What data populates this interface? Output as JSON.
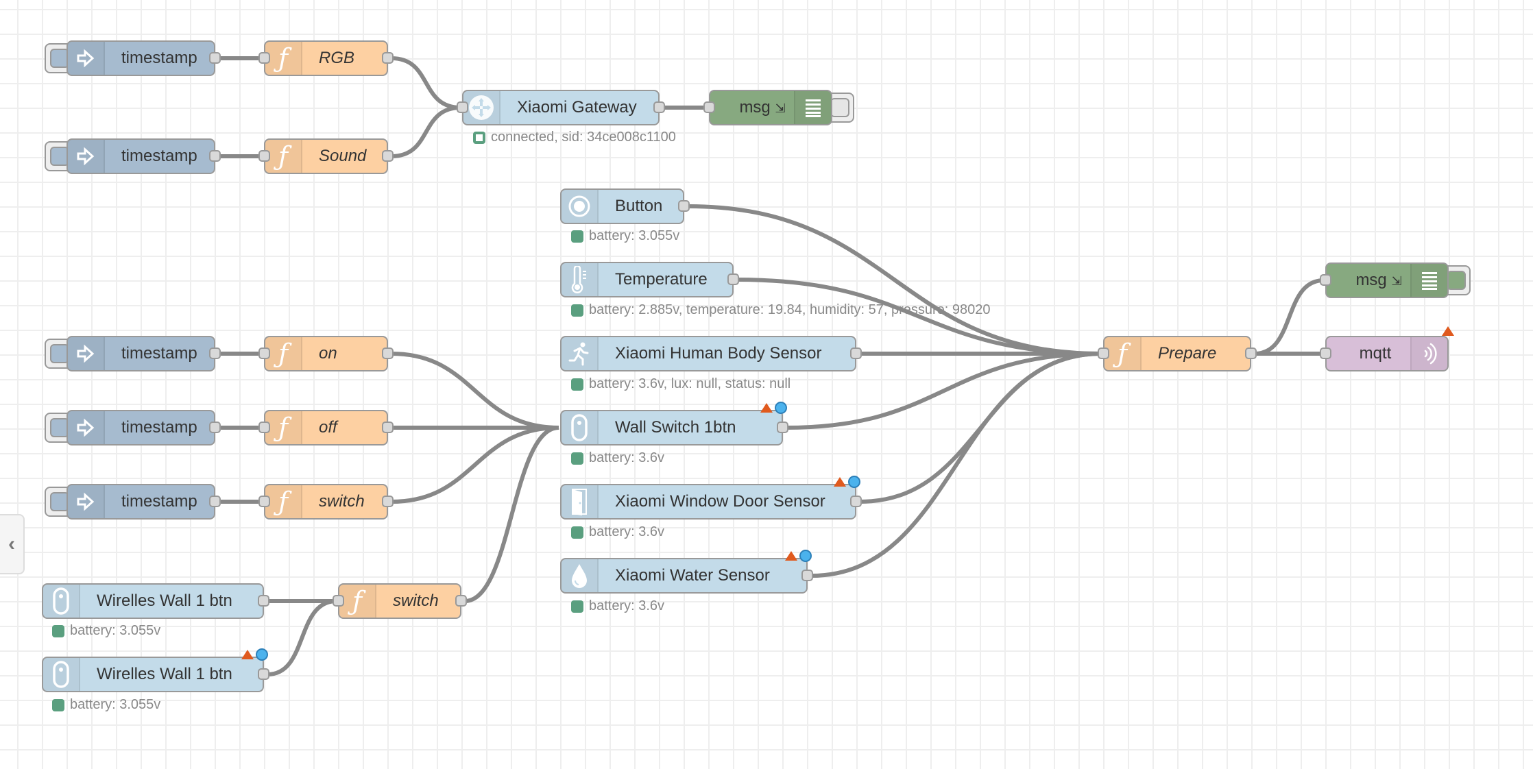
{
  "colors": {
    "inject": "#a6bbcf",
    "function": "#fdd0a2",
    "xiaomi": "#c3dbe9",
    "debug": "#87a980",
    "mqtt": "#d8bfd8",
    "wire": "#888888",
    "status_green": "#5a9f7f",
    "error_triangle": "#e05a1e",
    "changed_dot": "#4bb2ed"
  },
  "nodes": {
    "inject_rgb": {
      "type": "inject",
      "label": "timestamp",
      "icon": "arrow-in-icon"
    },
    "fn_rgb": {
      "type": "function",
      "label": "RGB",
      "icon": "function-icon"
    },
    "inject_sound": {
      "type": "inject",
      "label": "timestamp",
      "icon": "arrow-in-icon"
    },
    "fn_sound": {
      "type": "function",
      "label": "Sound",
      "icon": "function-icon"
    },
    "gateway": {
      "type": "xiaomi-gateway",
      "label": "Xiaomi Gateway",
      "icon": "gateway-icon",
      "status": "connected, sid: 34ce008c1100"
    },
    "debug_top": {
      "type": "debug",
      "label": "msg",
      "icon": "debug-list-icon",
      "active": false
    },
    "button": {
      "type": "xiaomi-button",
      "label": "Button",
      "icon": "button-icon",
      "status": "battery: 3.055v"
    },
    "temperature": {
      "type": "xiaomi-ht",
      "label": "Temperature",
      "icon": "thermometer-icon",
      "status": "battery: 2.885v, temperature: 19.84, humidity: 57, pressure: 98020"
    },
    "human_body": {
      "type": "xiaomi-motion",
      "label": "Xiaomi Human Body Sensor",
      "icon": "running-person-icon",
      "status": "battery: 3.6v, lux: null, status: null"
    },
    "wall_switch": {
      "type": "xiaomi-switch",
      "label": "Wall Switch 1btn",
      "icon": "wall-switch-icon",
      "status": "battery: 3.6v",
      "error": true,
      "changed": true
    },
    "window_door": {
      "type": "xiaomi-magnet",
      "label": "Xiaomi Window Door Sensor",
      "icon": "door-icon",
      "status": "battery: 3.6v",
      "error": true,
      "changed": true
    },
    "water": {
      "type": "xiaomi-leak",
      "label": "Xiaomi Water Sensor",
      "icon": "water-drop-icon",
      "status": "battery: 3.6v",
      "error": true,
      "changed": true
    },
    "inject_on": {
      "type": "inject",
      "label": "timestamp",
      "icon": "arrow-in-icon"
    },
    "fn_on": {
      "type": "function",
      "label": "on",
      "icon": "function-icon"
    },
    "inject_off": {
      "type": "inject",
      "label": "timestamp",
      "icon": "arrow-in-icon"
    },
    "fn_off": {
      "type": "function",
      "label": "off",
      "icon": "function-icon"
    },
    "inject_switch": {
      "type": "inject",
      "label": "timestamp",
      "icon": "arrow-in-icon"
    },
    "fn_switch": {
      "type": "function",
      "label": "switch",
      "icon": "function-icon"
    },
    "wireless1": {
      "type": "xiaomi-switch",
      "label": "Wirelles Wall 1 btn",
      "icon": "wall-switch-icon",
      "status": "battery: 3.055v"
    },
    "wireless2": {
      "type": "xiaomi-switch",
      "label": "Wirelles Wall 1 btn",
      "icon": "wall-switch-icon",
      "status": "battery: 3.055v",
      "error": true,
      "changed": true
    },
    "fn_switch2": {
      "type": "function",
      "label": "switch",
      "icon": "function-icon"
    },
    "prepare": {
      "type": "function",
      "label": "Prepare",
      "icon": "function-icon"
    },
    "debug_right": {
      "type": "debug",
      "label": "msg",
      "icon": "debug-list-icon",
      "active": true
    },
    "mqtt": {
      "type": "mqtt-out",
      "label": "mqtt",
      "icon": "mqtt-signal-icon",
      "error": true
    }
  },
  "wires": [
    [
      "inject_rgb",
      "fn_rgb"
    ],
    [
      "inject_sound",
      "fn_sound"
    ],
    [
      "fn_rgb",
      "gateway"
    ],
    [
      "fn_sound",
      "gateway"
    ],
    [
      "gateway",
      "debug_top"
    ],
    [
      "inject_on",
      "fn_on"
    ],
    [
      "inject_off",
      "fn_off"
    ],
    [
      "inject_switch",
      "fn_switch"
    ],
    [
      "fn_on",
      "wall_switch"
    ],
    [
      "fn_off",
      "wall_switch"
    ],
    [
      "fn_switch",
      "wall_switch"
    ],
    [
      "fn_switch2",
      "wall_switch"
    ],
    [
      "wireless1",
      "fn_switch2"
    ],
    [
      "wireless2",
      "fn_switch2"
    ],
    [
      "button",
      "prepare"
    ],
    [
      "temperature",
      "prepare"
    ],
    [
      "human_body",
      "prepare"
    ],
    [
      "wall_switch",
      "prepare"
    ],
    [
      "window_door",
      "prepare"
    ],
    [
      "water",
      "prepare"
    ],
    [
      "prepare",
      "debug_right"
    ],
    [
      "prepare",
      "mqtt"
    ]
  ],
  "sidebar_toggle": {
    "icon": "chevron-left-icon"
  }
}
